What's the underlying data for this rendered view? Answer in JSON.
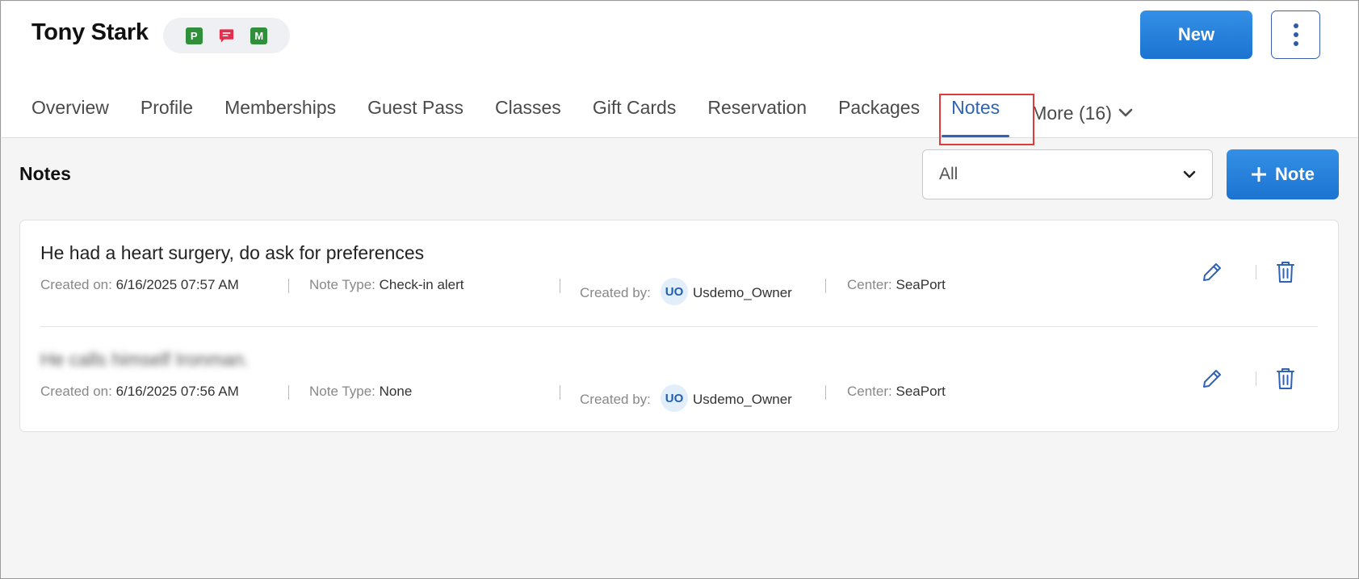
{
  "member": {
    "name": "Tony Stark",
    "badges": [
      {
        "icon": "p-badge-icon",
        "letter": "P",
        "color": "#2f8f3a"
      },
      {
        "icon": "chat-bubble-icon",
        "letter": "",
        "color": "#e0304b"
      },
      {
        "icon": "m-badge-icon",
        "letter": "M",
        "color": "#2f8f3a"
      }
    ]
  },
  "actions": {
    "new_label": "New"
  },
  "tabs": [
    {
      "label": "Overview",
      "active": false
    },
    {
      "label": "Profile",
      "active": false
    },
    {
      "label": "Memberships",
      "active": false
    },
    {
      "label": "Guest Pass",
      "active": false
    },
    {
      "label": "Classes",
      "active": false
    },
    {
      "label": "Gift Cards",
      "active": false
    },
    {
      "label": "Reservation",
      "active": false
    },
    {
      "label": "Packages",
      "active": false
    },
    {
      "label": "Notes",
      "active": true
    },
    {
      "label": "More (16)",
      "active": false
    }
  ],
  "section": {
    "title": "Notes",
    "filter_value": "All",
    "add_note_label": "Note"
  },
  "labels": {
    "created_on": "Created on:",
    "note_type": "Note Type:",
    "created_by": "Created by:",
    "center": "Center:"
  },
  "notes": [
    {
      "text": "He had a heart surgery, do ask for preferences",
      "blurred": false,
      "created_on": "6/16/2025 07:57 AM",
      "note_type": "Check-in alert",
      "creator_initials": "UO",
      "created_by": "Usdemo_Owner",
      "center": "SeaPort"
    },
    {
      "text": "He calls himself Ironman.",
      "blurred": true,
      "created_on": "6/16/2025 07:56 AM",
      "note_type": "None",
      "creator_initials": "UO",
      "created_by": "Usdemo_Owner",
      "center": "SeaPort"
    }
  ],
  "colors": {
    "accent": "#2e63b8",
    "primary_button": "#1f7bd9",
    "highlight": "#e03b3b"
  }
}
